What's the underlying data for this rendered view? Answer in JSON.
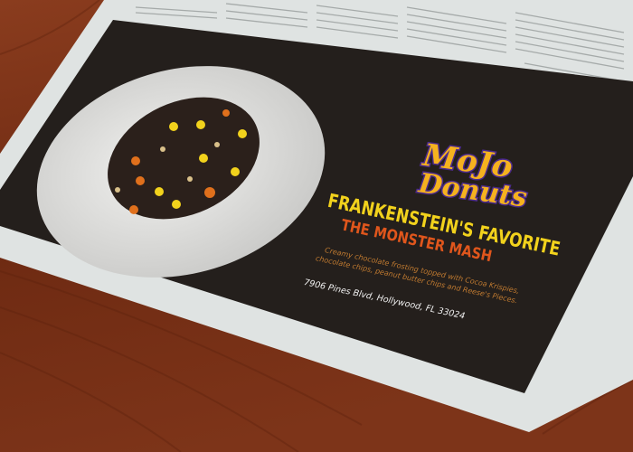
{
  "ad": {
    "brand_line1": "MoJo",
    "brand_line2": "Donuts",
    "headline": "FRANKENSTEIN'S FAVORITE",
    "subheadline": "THE MONSTER MASH",
    "description_line1": "Creamy chocolate frosting topped with Cocoa Krispies,",
    "description_line2": "chocolate chips, peanut butter chips and Reese's Pieces.",
    "address": "7906 Pines Blvd, Hollywood, FL 33024"
  },
  "colors": {
    "ad_background": "#241f1c",
    "headline": "#f2d21c",
    "subheadline": "#e0561c",
    "logo_fill": "#f5b21f",
    "logo_outline": "#4b2a8c",
    "wood": "#7a3218"
  }
}
